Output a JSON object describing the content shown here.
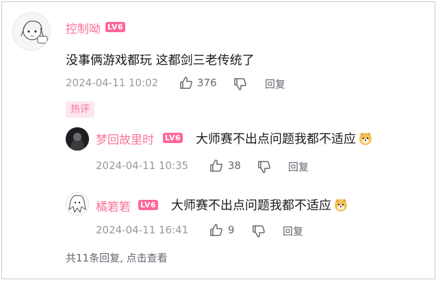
{
  "comment": {
    "username": "控制呦",
    "level": "LV6",
    "text": "没事俩游戏都玩 这都剑三老传统了",
    "time": "2024-04-11 10:02",
    "likes": "376",
    "reply_label": "回复",
    "tag": "热评"
  },
  "replies": [
    {
      "username": "梦回故里时",
      "level": "LV6",
      "text": "大师赛不出点问题我都不适应",
      "emoji": "dog-emoji",
      "time": "2024-04-11 10:35",
      "likes": "38",
      "reply_label": "回复"
    },
    {
      "username": "橘箬箬",
      "level": "LV6",
      "text": "大师赛不出点问题我都不适应",
      "emoji": "dog-emoji",
      "time": "2024-04-11 16:41",
      "likes": "9",
      "reply_label": "回复"
    }
  ],
  "footer": {
    "text": "共11条回复, 点击查看"
  },
  "colors": {
    "accent": "#fb7299",
    "level_badge": "#ff6699",
    "muted": "#9499a0"
  }
}
